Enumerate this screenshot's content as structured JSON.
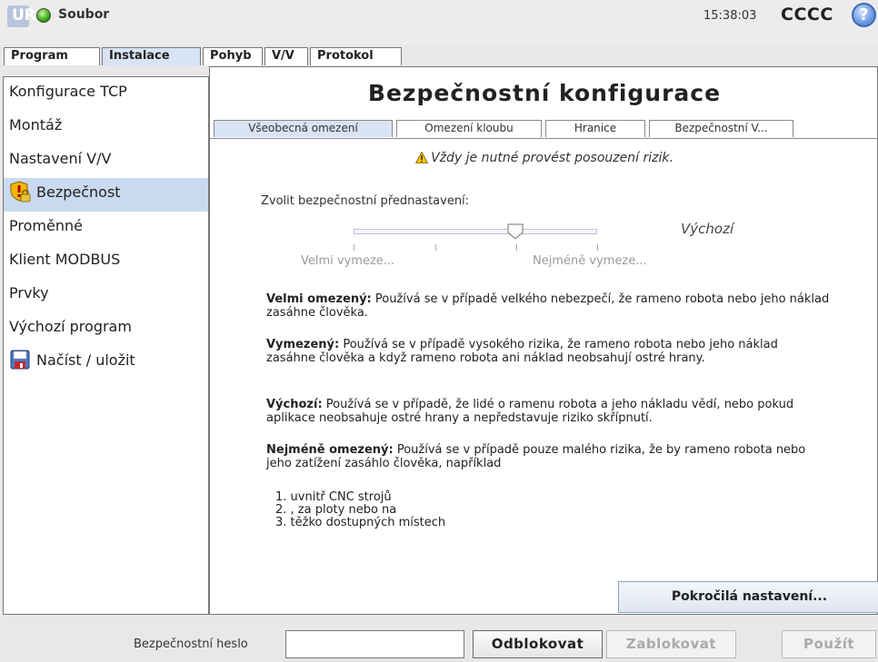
{
  "topbar": {
    "logo": "UR",
    "app_title": "Soubor",
    "clock": "15:38:03",
    "robot_name": "CCCC",
    "help_icon": "?"
  },
  "main_tabs": [
    "Program",
    "Instalace",
    "Pohyb",
    "V/V",
    "Protokol"
  ],
  "main_tabs_active": "Instalace",
  "sidebar": {
    "items": [
      {
        "label": "Konfigurace TCP",
        "icon": ""
      },
      {
        "label": "Montáž",
        "icon": ""
      },
      {
        "label": "Nastavení V/V",
        "icon": ""
      },
      {
        "label": "Bezpečnost",
        "icon": "safety-lock-icon"
      },
      {
        "label": "Proměnné",
        "icon": ""
      },
      {
        "label": "Klient MODBUS",
        "icon": ""
      },
      {
        "label": "Prvky",
        "icon": ""
      },
      {
        "label": "Výchozí program",
        "icon": ""
      },
      {
        "label": "Načíst / uložit",
        "icon": "floppy-disk-icon"
      }
    ],
    "active": "Bezpečnost"
  },
  "content": {
    "title": "Bezpečnostní konfigurace",
    "subtabs": [
      "Všeobecná omezení",
      "Omezení kloubu",
      "Hranice",
      "Bezpečnostní V..."
    ],
    "subtabs_active": "Všeobecná omezení",
    "warning": "Vždy je nutné provést posouzení rizik.",
    "preset_label": "Zvolit bezpečnostní přednastavení:",
    "slider": {
      "value_label": "Výchozí",
      "position_index": 2,
      "positions": 4,
      "min_label": "Velmi vymeze...",
      "max_label": "Nejméně vymeze..."
    },
    "descriptions": [
      {
        "title": "Velmi omezený:",
        "text": " Používá se v případě velkého nebezpečí, že rameno robota nebo jeho náklad zasáhne člověka."
      },
      {
        "title": "Vymezený:",
        "text": " Používá se v případě vysokého rizika, že rameno robota nebo jeho náklad zasáhne člověka a když rameno robota ani náklad neobsahují ostré hrany."
      },
      {
        "title": "Výchozí:",
        "text": " Používá se v případě, že lidé o ramenu robota a jeho nákladu vědí, nebo pokud aplikace neobsahuje ostré hrany a nepředstavuje riziko skřípnutí."
      },
      {
        "title": "Nejméně omezený:",
        "text": " Používá se v případě pouze malého rizika, že by rameno robota nebo jeho zatížení zasáhlo člověka, například"
      }
    ],
    "steps": [
      "1. uvnitř CNC strojů",
      "2. , za ploty nebo na",
      "3. těžko dostupných místech"
    ],
    "advanced_button": "Pokročilá nastavení..."
  },
  "bottombar": {
    "password_label": "Bezpečnostní heslo",
    "password_value": "",
    "unlock_button": "Odblokovat",
    "lock_button": "Zablokovat",
    "apply_button": "Použít"
  },
  "colors": {
    "active_tab": "#d8e4f3",
    "active_nav": "#c9d9ef",
    "status_ok": "#35a80e",
    "help_blue": "#5b8ede"
  }
}
